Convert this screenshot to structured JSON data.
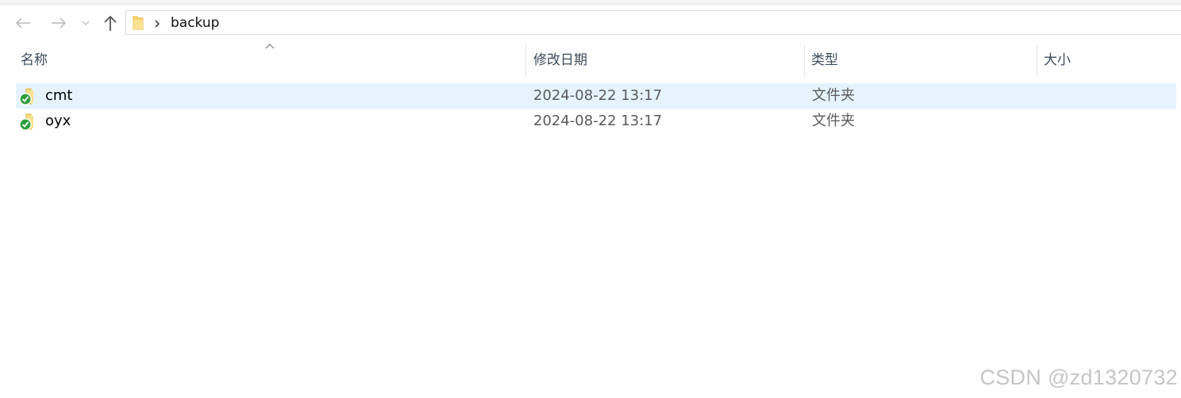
{
  "address_bar": {
    "path_segments": [
      "backup"
    ],
    "folder_icon": "folder-icon",
    "separator_icon": "chevron-right-icon"
  },
  "nav": {
    "back_icon": "arrow-left-icon",
    "forward_icon": "arrow-right-icon",
    "recent_icon": "chevron-down-icon",
    "up_icon": "arrow-up-icon"
  },
  "columns": [
    {
      "label": "名称",
      "sorted": "ascending"
    },
    {
      "label": "修改日期"
    },
    {
      "label": "类型"
    },
    {
      "label": "大小"
    }
  ],
  "files": [
    {
      "name": "cmt",
      "modified": "2024-08-22 13:17",
      "type": "文件夹",
      "size": "",
      "icon": "folder-synced-icon",
      "selected": true
    },
    {
      "name": "oyx",
      "modified": "2024-08-22 13:17",
      "type": "文件夹",
      "size": "",
      "icon": "folder-synced-icon",
      "selected": false
    }
  ],
  "colors": {
    "selection": "#e5f3ff",
    "folder": "#f8d775",
    "sync_badge": "#2e9e3a"
  },
  "watermark": "CSDN @zd1320732"
}
